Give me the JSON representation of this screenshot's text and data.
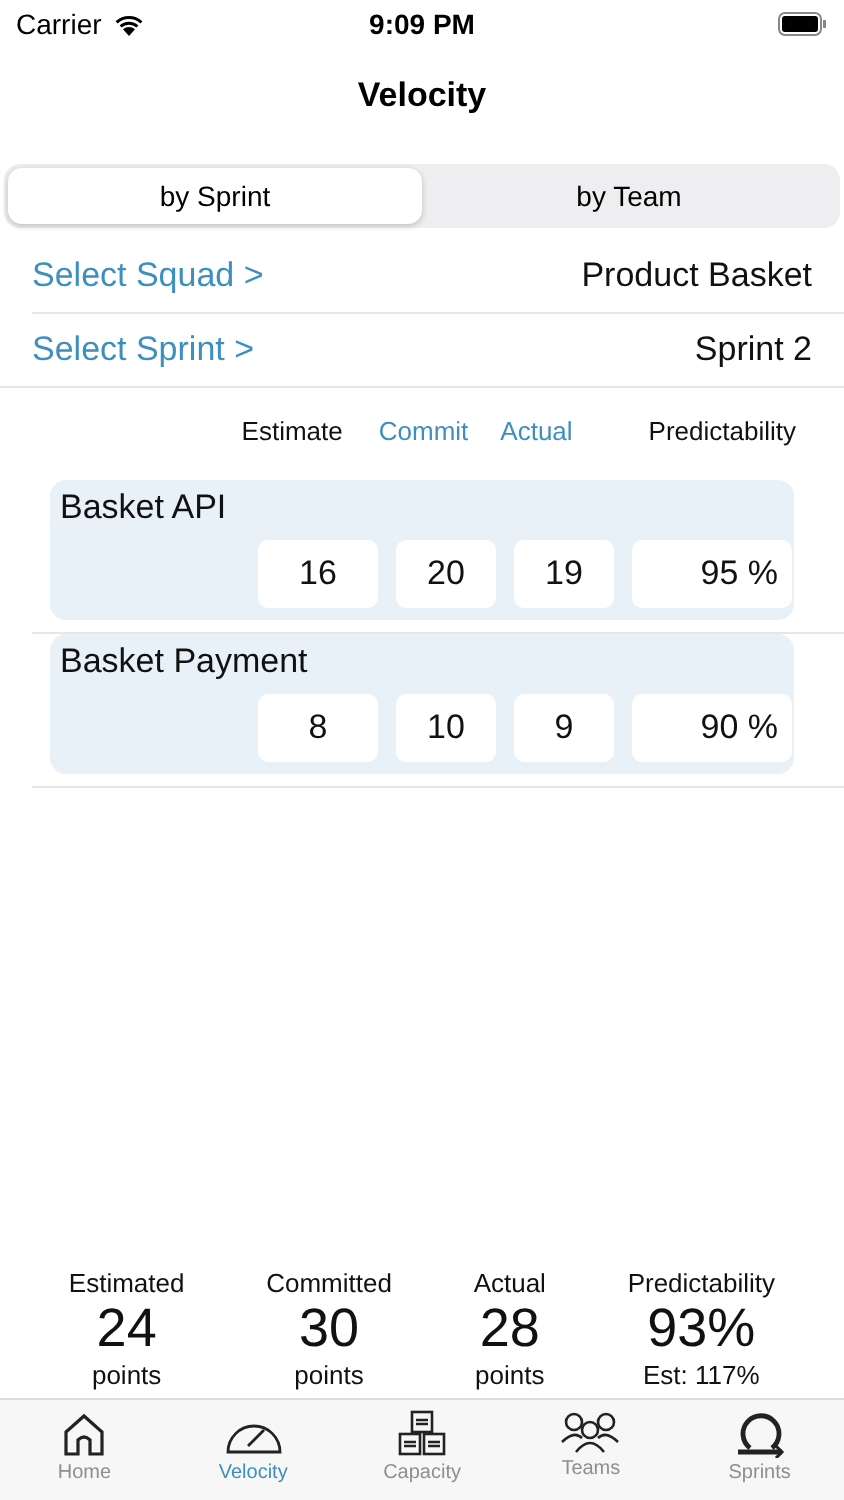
{
  "status_bar": {
    "carrier": "Carrier",
    "time": "9:09 PM"
  },
  "title": "Velocity",
  "segments": [
    {
      "label": "by Sprint",
      "selected": true
    },
    {
      "label": "by Team",
      "selected": false
    }
  ],
  "pickers": [
    {
      "action": "Select Squad >",
      "value": "Product Basket"
    },
    {
      "action": "Select Sprint >",
      "value": "Sprint 2"
    }
  ],
  "columns": [
    {
      "label": "Estimate",
      "highlighted": false
    },
    {
      "label": "Commit",
      "highlighted": true
    },
    {
      "label": "Actual",
      "highlighted": true
    },
    {
      "label": "Predictability",
      "highlighted": false
    }
  ],
  "teams": [
    {
      "name": "Basket API",
      "values": [
        "16",
        "20",
        "19",
        "95 %"
      ]
    },
    {
      "name": "Basket Payment",
      "values": [
        "8",
        "10",
        "9",
        "90 %"
      ]
    }
  ],
  "summary": [
    {
      "label": "Estimated",
      "value": "24",
      "note": "points"
    },
    {
      "label": "Committed",
      "value": "30",
      "note": "points"
    },
    {
      "label": "Actual",
      "value": "28",
      "note": "points"
    },
    {
      "label": "Predictability",
      "value": "93%",
      "note": "Est: 117%"
    }
  ],
  "tab_bar": [
    {
      "label": "Home",
      "selected": false
    },
    {
      "label": "Velocity",
      "selected": true
    },
    {
      "label": "Capacity",
      "selected": false
    },
    {
      "label": "Teams",
      "selected": false
    },
    {
      "label": "Sprints",
      "selected": false
    }
  ]
}
